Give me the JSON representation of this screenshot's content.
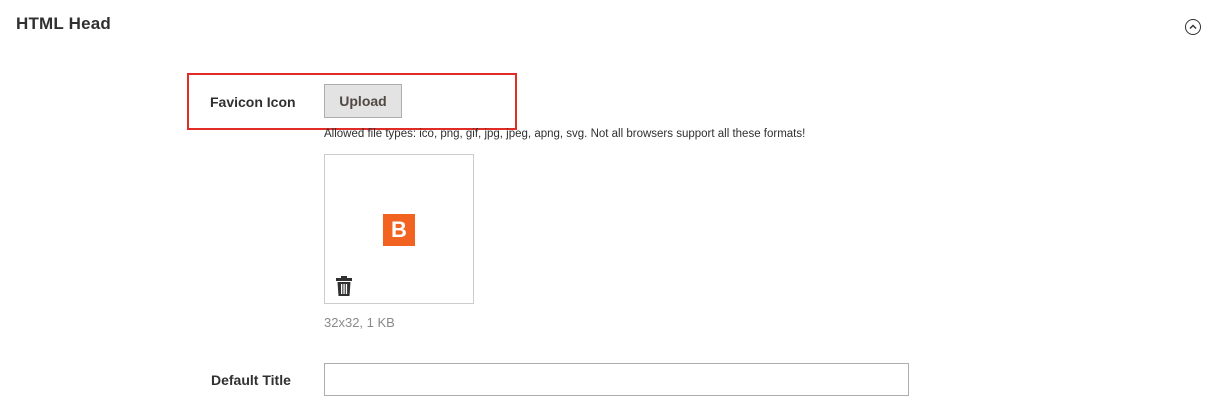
{
  "section": {
    "title": "HTML Head",
    "collapse_icon": "chevron-up-circle-icon"
  },
  "favicon": {
    "label": "Favicon Icon",
    "upload_label": "Upload",
    "allowed_note": "Allowed file types: ico, png, gif, jpg, jpeg, apng, svg. Not all browsers support all these formats!",
    "preview_letter": "B",
    "preview_color": "#f26322",
    "delete_icon": "trash-icon",
    "file_meta": "32x32, 1 KB"
  },
  "default_title": {
    "label": "Default Title",
    "value": ""
  },
  "colors": {
    "highlight": "#e02b27",
    "text": "#303030",
    "muted": "#8a8a8a"
  }
}
